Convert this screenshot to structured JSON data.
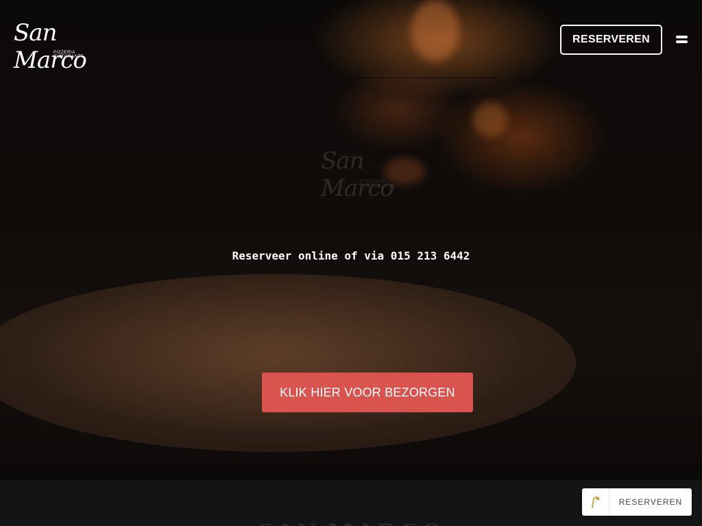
{
  "header": {
    "logo": {
      "script": "San Marco",
      "subtitle": "PIZZERIA RISTORANTE"
    },
    "reserve_button": "RESERVEREN",
    "menu_icon": "hamburger-menu-icon"
  },
  "hero": {
    "center_logo": {
      "script": "San Marco",
      "subtitle": "PIZZERIA RISTORANTE"
    },
    "tagline": "Reserveer online of via 015 213 6442",
    "delivery_button": "KLIK HIER VOOR BEZORGEN"
  },
  "section": {
    "heading": "SAN MARCO"
  },
  "widget": {
    "icon": "reservation-widget-icon",
    "label": "RESERVEREN"
  },
  "colors": {
    "accent": "#d9534f",
    "background": "#141414"
  }
}
